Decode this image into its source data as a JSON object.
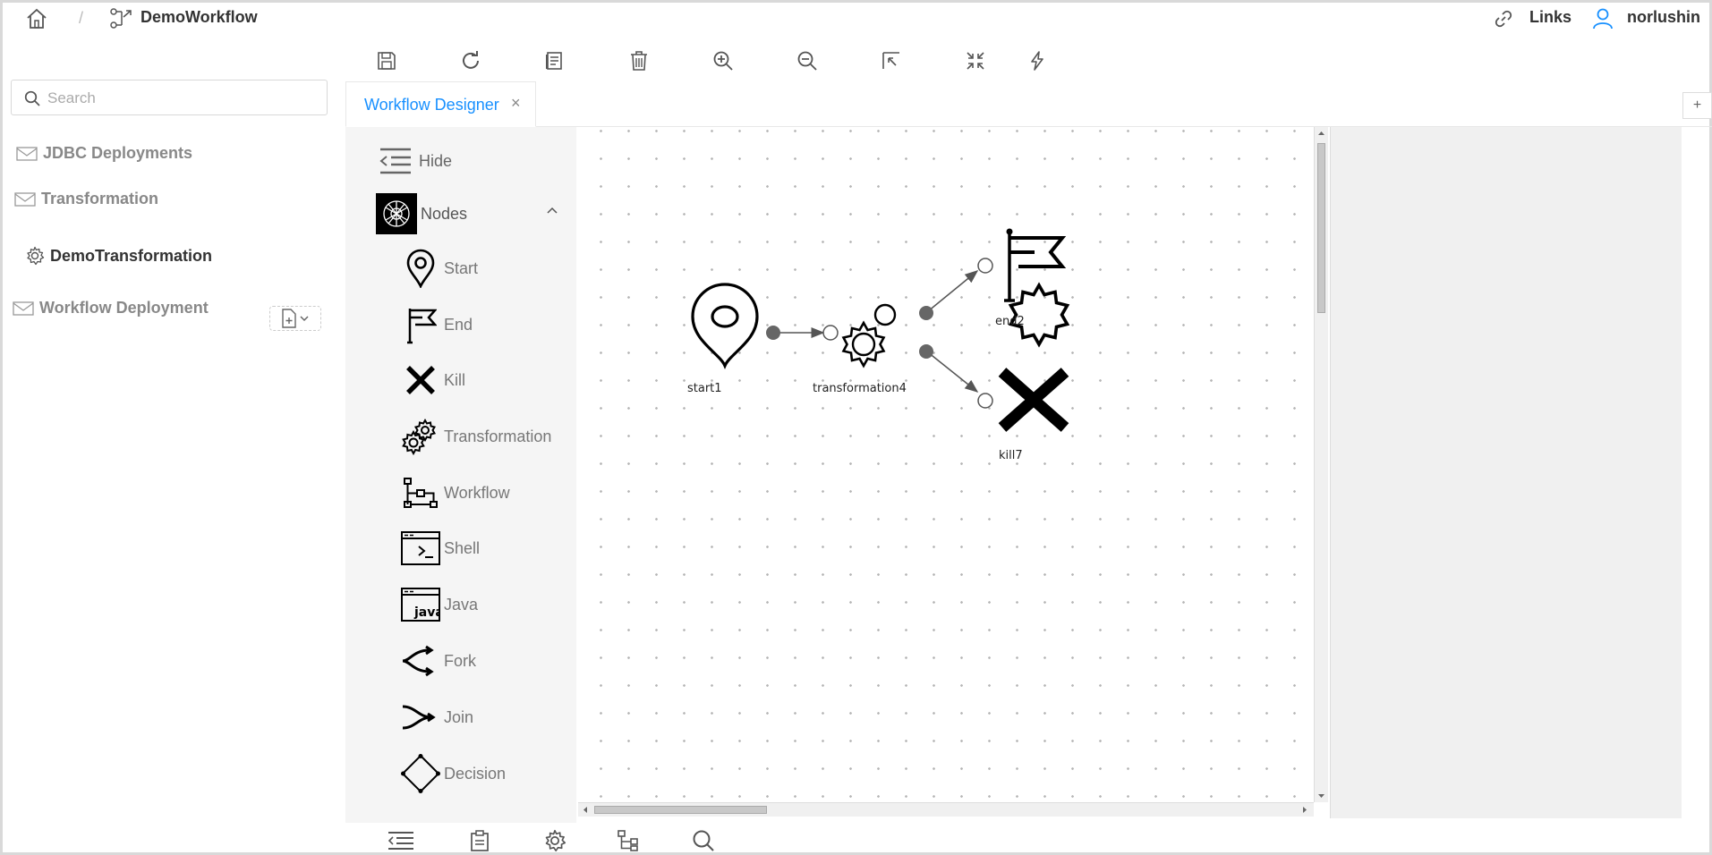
{
  "header": {
    "breadcrumb_separator": "/",
    "workflow_title": "DemoWorkflow",
    "links_label": "Links",
    "user_name": "norlushin"
  },
  "toolbar": {
    "buttons": [
      "save-icon",
      "refresh-icon",
      "document-icon",
      "delete-icon",
      "zoom-in-icon",
      "zoom-out-icon",
      "fit-icon",
      "collapse-icon",
      "lightning-icon"
    ]
  },
  "sidebar": {
    "search_placeholder": "Search",
    "items": [
      {
        "label": "JDBC Deployments"
      },
      {
        "label": "Transformation"
      },
      {
        "label": "DemoTransformation"
      },
      {
        "label": "Workflow Deployment"
      }
    ]
  },
  "tabs": [
    {
      "label": "Workflow Designer",
      "close": "×"
    }
  ],
  "tab_add_label": "+",
  "palette": {
    "hide_label": "Hide",
    "nodes_label": "Nodes",
    "items": [
      {
        "label": "Start",
        "icon": "pin-icon"
      },
      {
        "label": "End",
        "icon": "flag-icon"
      },
      {
        "label": "Kill",
        "icon": "x-icon"
      },
      {
        "label": "Transformation",
        "icon": "gears-icon"
      },
      {
        "label": "Workflow",
        "icon": "hierarchy-icon"
      },
      {
        "label": "Shell",
        "icon": "terminal-icon"
      },
      {
        "label": "Java",
        "icon": "java-icon"
      },
      {
        "label": "Fork",
        "icon": "fork-icon"
      },
      {
        "label": "Join",
        "icon": "join-icon"
      },
      {
        "label": "Decision",
        "icon": "diamond-icon"
      }
    ]
  },
  "diagram": {
    "nodes": [
      {
        "id": "start1",
        "type": "start"
      },
      {
        "id": "transformation4",
        "type": "transformation"
      },
      {
        "id": "end2",
        "type": "end"
      },
      {
        "id": "kill7",
        "type": "kill"
      }
    ],
    "edges": [
      {
        "from": "start1",
        "to": "transformation4"
      },
      {
        "from": "transformation4",
        "to": "end2"
      },
      {
        "from": "transformation4",
        "to": "kill7"
      }
    ]
  },
  "bottom_toolbar": {
    "buttons": [
      "outdent-icon",
      "clipboard-icon",
      "settings-icon",
      "tree-icon",
      "search-icon"
    ]
  },
  "colors": {
    "accent": "#1890ff",
    "palette_bg": "#f5f5f5",
    "panel_bg": "#f0f0f0"
  }
}
